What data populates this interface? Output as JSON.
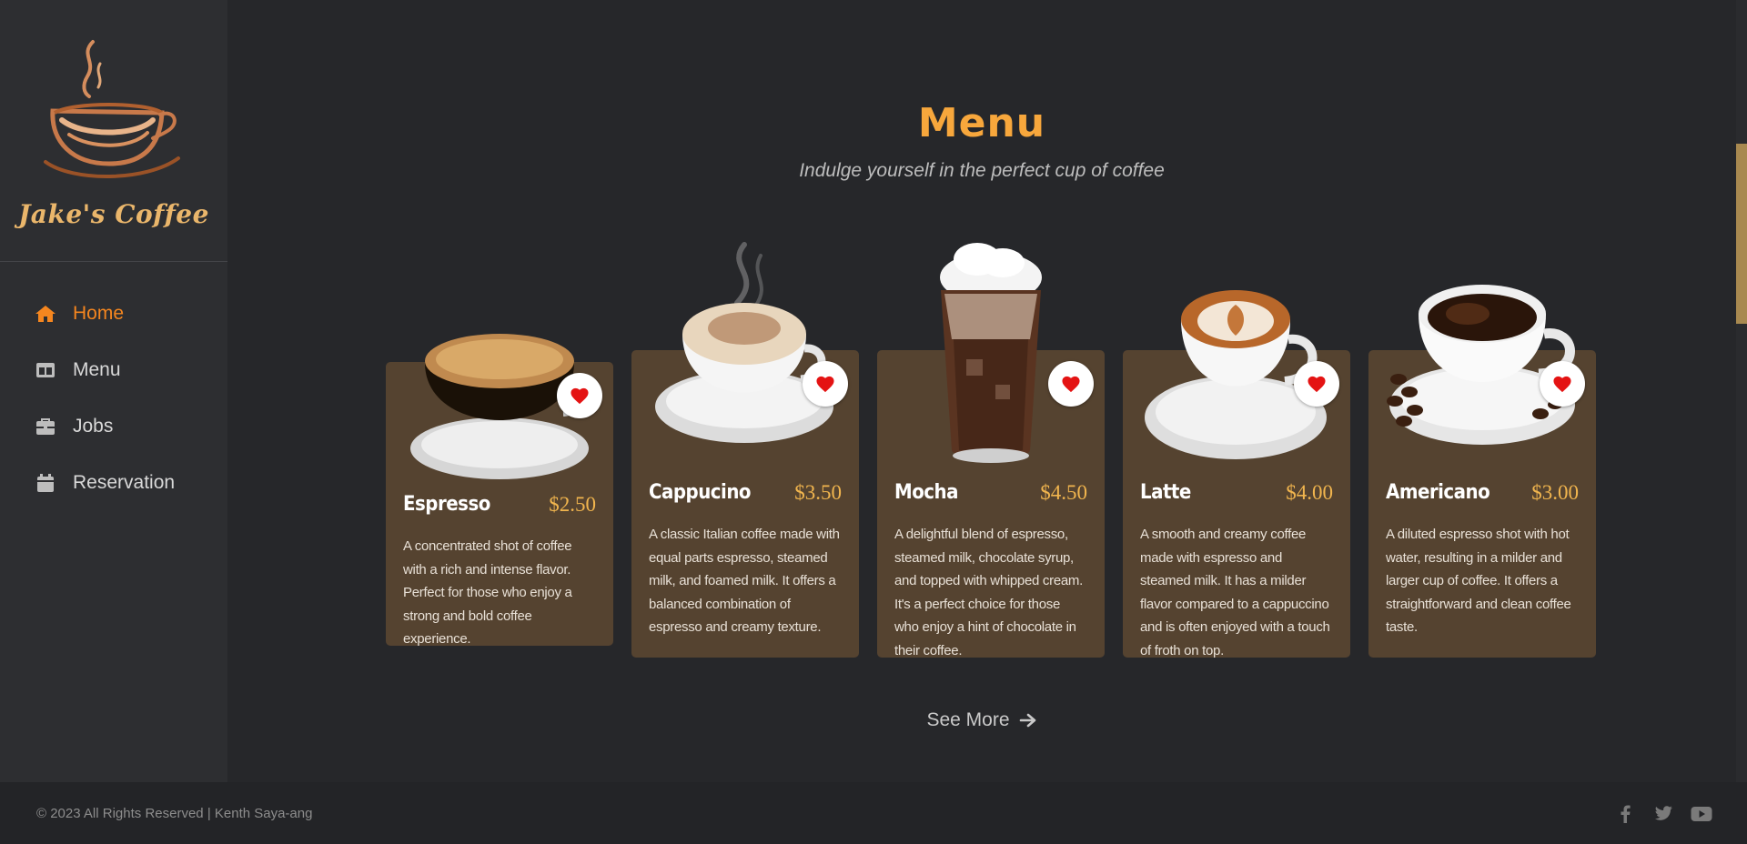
{
  "brand": {
    "name": "Jake's Coffee",
    "logo_icon": "coffee-cup-icon"
  },
  "sidebar": {
    "items": [
      {
        "label": "Home",
        "icon": "home-icon",
        "active": true
      },
      {
        "label": "Menu",
        "icon": "menu-book-icon",
        "active": false
      },
      {
        "label": "Jobs",
        "icon": "briefcase-icon",
        "active": false
      },
      {
        "label": "Reservation",
        "icon": "calendar-icon",
        "active": false
      }
    ]
  },
  "main": {
    "title": "Menu",
    "subtitle": "Indulge yourself in the perfect cup of coffee",
    "see_more": "See More",
    "products": [
      {
        "name": "Espresso",
        "price": "$2.50",
        "description": "A concentrated shot of coffee with a rich and intense flavor. Perfect for those who enjoy a strong and bold coffee experience."
      },
      {
        "name": "Cappucino",
        "price": "$3.50",
        "description": "A classic Italian coffee made with equal parts espresso, steamed milk, and foamed milk. It offers a balanced combination of espresso and creamy texture."
      },
      {
        "name": "Mocha",
        "price": "$4.50",
        "description": "A delightful blend of espresso, steamed milk, chocolate syrup, and topped with whipped cream. It's a perfect choice for those who enjoy a hint of chocolate in their coffee."
      },
      {
        "name": "Latte",
        "price": "$4.00",
        "description": "A smooth and creamy coffee made with espresso and steamed milk. It has a milder flavor compared to a cappuccino and is often enjoyed with a touch of froth on top."
      },
      {
        "name": "Americano",
        "price": "$3.00",
        "description": "A diluted espresso shot with hot water, resulting in a milder and larger cup of coffee. It offers a straightforward and clean coffee taste."
      }
    ]
  },
  "footer": {
    "copyright": "© 2023 All Rights Reserved | Kenth Saya-ang",
    "social": [
      "facebook-icon",
      "twitter-icon",
      "youtube-icon"
    ]
  },
  "colors": {
    "background": "#26272a",
    "sidebar": "#2d2e31",
    "accent": "#f5861f",
    "title": "#f7a73c",
    "card": "#554330",
    "price": "#f1b54e",
    "favorite": "#e41313"
  }
}
